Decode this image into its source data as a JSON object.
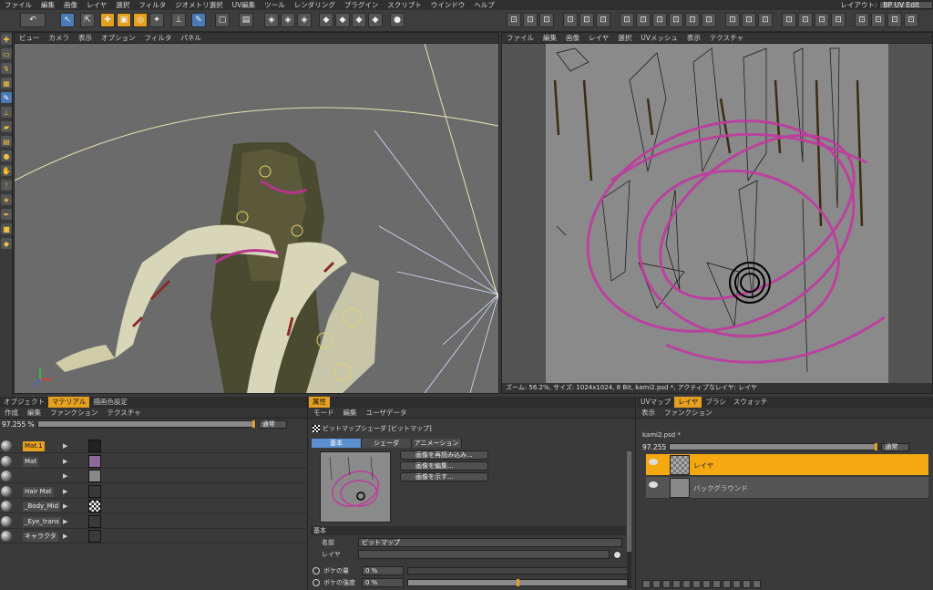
{
  "menubar": {
    "items": [
      "ファイル",
      "編集",
      "画像",
      "レイヤ",
      "選択",
      "フィルタ",
      "ジオメトリ選択",
      "UV編集",
      "ツール",
      "レンダリング",
      "プラグイン",
      "スクリプト",
      "ウインドウ",
      "ヘルプ"
    ],
    "layout_label": "レイアウト:",
    "layout_value": "BP UV Edit"
  },
  "viewport": {
    "menu": [
      "ビュー",
      "カメラ",
      "表示",
      "オプション",
      "フィルタ",
      "パネル"
    ]
  },
  "uv_editor": {
    "menu": [
      "ファイル",
      "編集",
      "画像",
      "レイヤ",
      "選択",
      "UVメッシュ",
      "表示",
      "テクスチャ"
    ],
    "status": "ズーム: 56.2%, サイズ: 1024x1024, 8 Bit, kami2.psd *, アクティブなレイヤ: レイヤ"
  },
  "material_panel": {
    "tabs": [
      "オブジェクト",
      "マテリアル",
      "描画色設定"
    ],
    "active_tab": "マテリアル",
    "menu": [
      "作成",
      "編集",
      "ファンクション",
      "テクスチャ"
    ],
    "opacity": "97.255 %",
    "blend_mode": "通常",
    "materials": [
      {
        "name": "Mat.1"
      },
      {
        "name": "Mat"
      },
      {
        "name": ""
      },
      {
        "name": "Hair Mat"
      },
      {
        "name": "_Body_Mid"
      },
      {
        "name": "_Eye_trans"
      },
      {
        "name": "キャラクタ"
      }
    ]
  },
  "attribute_panel": {
    "tab": "属性",
    "menu": [
      "モード",
      "編集",
      "ユーザデータ"
    ],
    "title": "ビットマップシェーダ [ビットマップ]",
    "subtabs": [
      "基本",
      "シェーダ",
      "アニメーション"
    ],
    "active_subtab": "基本",
    "buttons": [
      "画像を再読み込み...",
      "画像を編集...",
      "画像を示す..."
    ],
    "section": "基本",
    "name_label": "名前",
    "name_value": "ビットマップ",
    "layer_label": "レイヤ",
    "blur_offset_label": "ボケの量",
    "blur_offset_value": "0 %",
    "blur_scale_label": "ボケの強度",
    "blur_scale_value": "0 %"
  },
  "layer_panel": {
    "tabs": [
      "UVマップ",
      "レイヤ",
      "ブラシ",
      "スウォッチ"
    ],
    "active_tab": "レイヤ",
    "menu": [
      "表示",
      "ファンクション"
    ],
    "file": "kami2.psd *",
    "opacity": "97.255",
    "blend_mode": "通常",
    "layers": [
      {
        "name": "レイヤ",
        "active": true
      },
      {
        "name": "バックグラウンド",
        "active": false
      }
    ]
  }
}
